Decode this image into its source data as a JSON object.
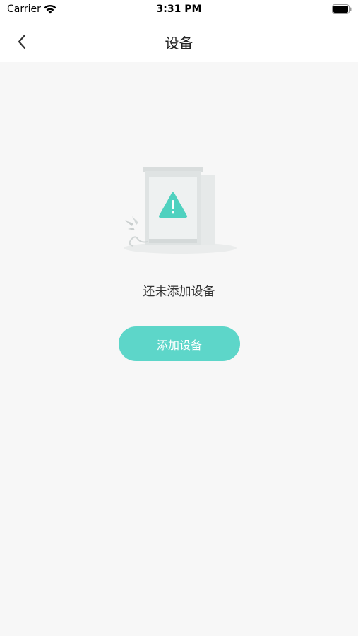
{
  "status_bar": {
    "carrier": "Carrier",
    "time": "3:31 PM"
  },
  "nav": {
    "title": "设备"
  },
  "empty_state": {
    "message": "还未添加设备",
    "add_button_label": "添加设备"
  },
  "colors": {
    "accent": "#5dd6c9",
    "background": "#f7f7f7",
    "warning_icon": "#4fd1bf"
  },
  "icons": {
    "back": "chevron-left-icon",
    "wifi": "wifi-icon",
    "battery": "battery-icon",
    "empty_illustration": "device-warning-illustration"
  }
}
